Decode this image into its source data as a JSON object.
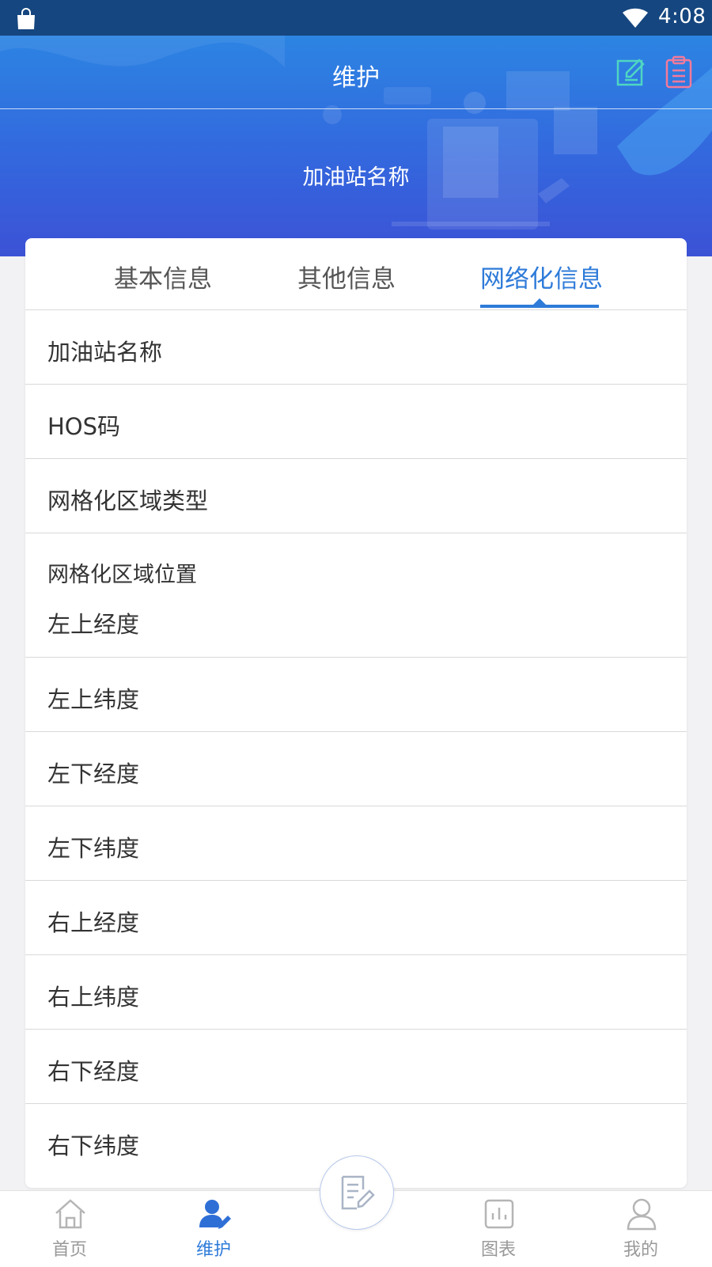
{
  "status_bar": {
    "time": "4:08"
  },
  "header": {
    "title": "维护",
    "station_name": "加油站名称"
  },
  "tabs": [
    {
      "label": "基本信息",
      "active": false
    },
    {
      "label": "其他信息",
      "active": false
    },
    {
      "label": "网络化信息",
      "active": true
    }
  ],
  "fields": {
    "station_name": "加油站名称",
    "hos_code": "HOS码",
    "grid_area_type": "网格化区域类型",
    "grid_area_location": "网格化区域位置",
    "top_left_lng": "左上经度",
    "top_left_lat": "左上纬度",
    "bottom_left_lng": "左下经度",
    "bottom_left_lat": "左下纬度",
    "top_right_lng": "右上经度",
    "top_right_lat": "右上纬度",
    "bottom_right_lng": "右下经度",
    "bottom_right_lat": "右下纬度"
  },
  "bottom_nav": {
    "home": "首页",
    "maintenance": "维护",
    "chart": "图表",
    "mine": "我的",
    "active": "maintenance"
  },
  "colors": {
    "accent": "#2e7bd9",
    "status_bar": "#15467f",
    "header_top": "#2a8de4",
    "header_bottom": "#3c52d6",
    "edit_icon": "#4fd6c2",
    "clipboard_icon": "#f47a9a"
  }
}
